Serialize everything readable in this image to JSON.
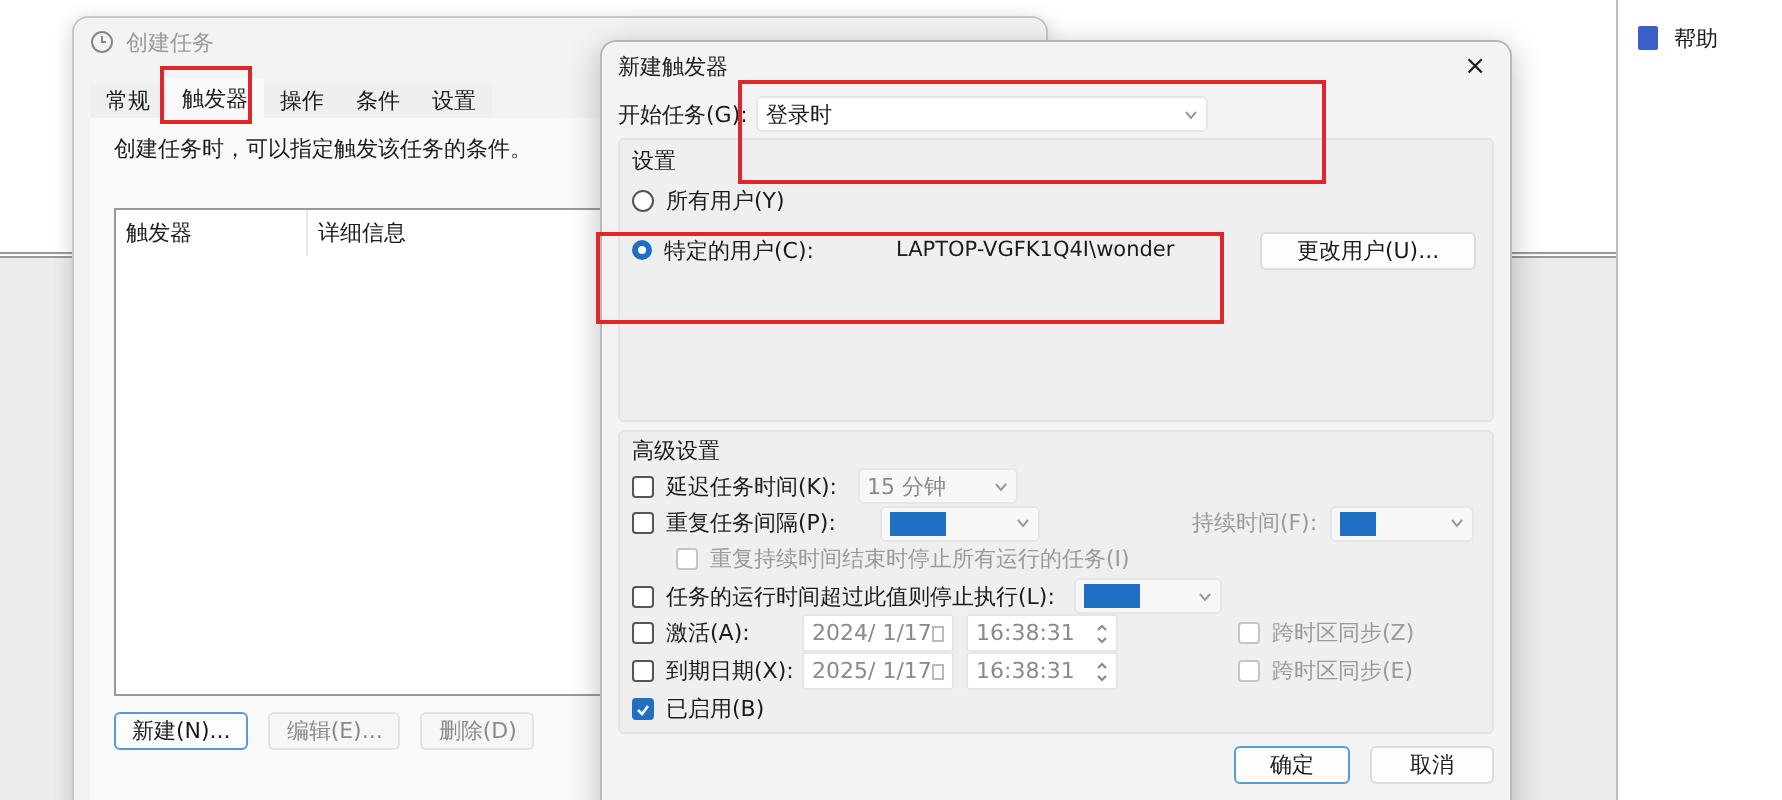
{
  "background_window": {
    "side_items": [
      {
        "label": "帮助"
      }
    ]
  },
  "task_window": {
    "title": "创建任务",
    "tabs": [
      {
        "label": "常规",
        "selected": false
      },
      {
        "label": "触发器",
        "selected": true
      },
      {
        "label": "操作",
        "selected": false
      },
      {
        "label": "条件",
        "selected": false
      },
      {
        "label": "设置",
        "selected": false
      }
    ],
    "description": "创建任务时，可以指定触发该任务的条件。",
    "columns": [
      "触发器",
      "详细信息"
    ],
    "buttons": [
      {
        "label": "新建(N)...",
        "disabled": false
      },
      {
        "label": "编辑(E)...",
        "disabled": true
      },
      {
        "label": "删除(D)",
        "disabled": true
      }
    ]
  },
  "trigger_dialog": {
    "title": "新建触发器",
    "close": "×",
    "begin": {
      "label": "开始任务(G):",
      "value": "登录时"
    },
    "settings": {
      "title": "设置",
      "options": [
        {
          "label": "所有用户(Y)",
          "selected": false
        },
        {
          "label": "特定的用户(C):",
          "selected": true,
          "user": "LAPTOP-VGFK1Q4I\\wonder"
        }
      ],
      "change_user_button": "更改用户(U)..."
    },
    "advanced": {
      "title": "高级设置",
      "rows": [
        {
          "kind": "select",
          "label": "延迟任务时间(K):",
          "checked": false,
          "value": "15 分钟"
        },
        {
          "kind": "select_pair",
          "label": "重复任务间隔(P):",
          "checked": false,
          "extra_label": "持续时间(F):"
        },
        {
          "kind": "sub_check",
          "label": "重复持续时间结束时停止所有运行的任务(I)",
          "checked": false
        },
        {
          "kind": "select",
          "label": "任务的运行时间超过此值则停止执行(L):",
          "checked": false
        },
        {
          "kind": "datetime",
          "label": "激活(A):",
          "checked": false,
          "date": "2024/ 1/17",
          "time": "16:38:31",
          "sync_label": "跨时区同步(Z)",
          "sync_checked": false
        },
        {
          "kind": "datetime",
          "label": "到期日期(X):",
          "checked": false,
          "date": "2025/ 1/17",
          "time": "16:38:31",
          "sync_label": "跨时区同步(E)",
          "sync_checked": false
        },
        {
          "kind": "check",
          "label": "已启用(B)",
          "checked": true
        }
      ]
    },
    "buttons": [
      "确定",
      "取消"
    ]
  }
}
